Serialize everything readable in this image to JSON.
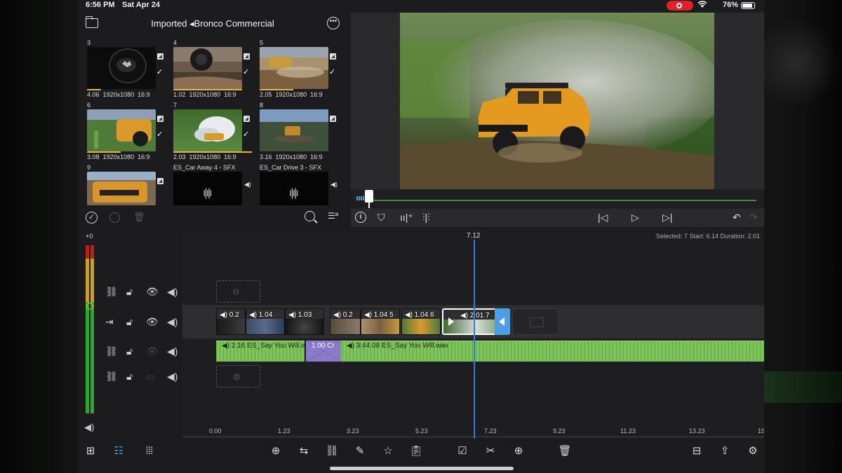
{
  "status": {
    "time": "6:56 PM",
    "date": "Sat Apr 24",
    "battery": "76%",
    "wifi_icon": "wifi-icon"
  },
  "browser": {
    "title": "Imported ◂Bronco Commercial",
    "clips": [
      {
        "num": "3",
        "duration": "4.06",
        "res": "1920x1080",
        "aspect": "16:9",
        "checked": true,
        "used_fraction": 0.2
      },
      {
        "num": "4",
        "duration": "1.02",
        "res": "1920x1080",
        "aspect": "16:9",
        "checked": true,
        "used_fraction": 0.9
      },
      {
        "num": "5",
        "duration": "2.05",
        "res": "1920x1080",
        "aspect": "16:9",
        "checked": true,
        "used_fraction": 0.5
      },
      {
        "num": "6",
        "duration": "3.08",
        "res": "1920x1080",
        "aspect": "16:9",
        "checked": true,
        "used_fraction": 0.5
      },
      {
        "num": "7",
        "duration": "2.03",
        "res": "1920x1080",
        "aspect": "16:9",
        "checked": true,
        "used_fraction": 1.0
      },
      {
        "num": "8",
        "duration": "3.16",
        "res": "1920x1080",
        "aspect": "16:9",
        "checked": false,
        "used_fraction": 0
      },
      {
        "num": "9",
        "label": ""
      },
      {
        "num": "",
        "label": "ES_Car Away 4 - SFX Prod..."
      },
      {
        "num": "",
        "label": "ES_Car Drive 3 - SFX Prod..."
      }
    ]
  },
  "timeline": {
    "meter_label": "+0",
    "playhead": "7.12",
    "selection_info": "Selected: 7 Start: 6.14 Duration: 2.01",
    "video_clips": [
      {
        "label": "◀) 0.2"
      },
      {
        "label": "◀) 1.04"
      },
      {
        "label": "◀) 1.03"
      },
      {
        "label": "◀) 0.2"
      },
      {
        "label": "◀) 1.04 5"
      },
      {
        "label": "◀) 1.04 6"
      },
      {
        "label": "◀) 2.01 7"
      }
    ],
    "audio_clips": [
      {
        "label": "◀) 2.16  ES_Say You Will.w"
      },
      {
        "label": "◀) 3:44.08  ES_Say You Will.wav"
      }
    ],
    "transition": "1.00  Cr",
    "ruler": [
      "0.00",
      "1.23",
      "3.23",
      "5.23",
      "7.23",
      "9.23",
      "11.23",
      "13.23",
      "15"
    ]
  },
  "colors": {
    "playhead": "#2f7de1",
    "audio": "#7fc45a",
    "transition": "#8b7ac7",
    "selection": "#4a9fe8",
    "used_bar": "#e7b43a"
  }
}
